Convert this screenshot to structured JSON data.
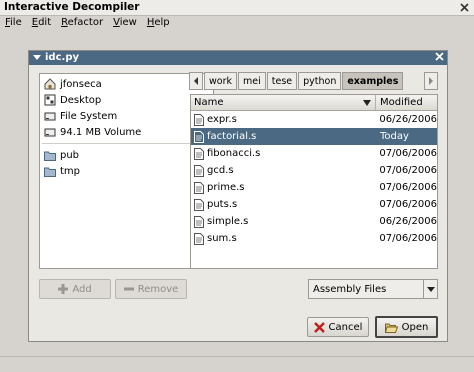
{
  "window": {
    "title": "Interactive Decompiler"
  },
  "menu": [
    {
      "pre": "",
      "u": "F",
      "post": "ile"
    },
    {
      "pre": "",
      "u": "E",
      "post": "dit"
    },
    {
      "pre": "",
      "u": "R",
      "post": "efactor"
    },
    {
      "pre": "",
      "u": "V",
      "post": "iew"
    },
    {
      "pre": "",
      "u": "H",
      "post": "elp"
    }
  ],
  "dialog": {
    "title": "idc.py",
    "places": [
      {
        "label": "jfonseca",
        "icon": "home-icon"
      },
      {
        "label": "Desktop",
        "icon": "desktop-icon"
      },
      {
        "label": "File System",
        "icon": "filesystem-icon"
      },
      {
        "label": "94.1 MB Volume",
        "icon": "volume-icon"
      }
    ],
    "bookmarks": [
      {
        "label": "pub",
        "icon": "folder-icon"
      },
      {
        "label": "tmp",
        "icon": "folder-icon"
      }
    ],
    "path": [
      "work",
      "mei",
      "tese",
      "python",
      "examples"
    ],
    "columns": {
      "name": "Name",
      "modified": "Modified"
    },
    "files": [
      {
        "name": "expr.s",
        "date": "06/26/2006"
      },
      {
        "name": "factorial.s",
        "date": "Today"
      },
      {
        "name": "fibonacci.s",
        "date": "07/06/2006"
      },
      {
        "name": "gcd.s",
        "date": "07/06/2006"
      },
      {
        "name": "prime.s",
        "date": "07/06/2006"
      },
      {
        "name": "puts.s",
        "date": "07/06/2006"
      },
      {
        "name": "simple.s",
        "date": "06/26/2006"
      },
      {
        "name": "sum.s",
        "date": "07/06/2006"
      }
    ],
    "selected_index": 1,
    "add_label": "Add",
    "remove_label": "Remove",
    "filter": "Assembly Files",
    "cancel_label": "Cancel",
    "open_label": "Open"
  }
}
